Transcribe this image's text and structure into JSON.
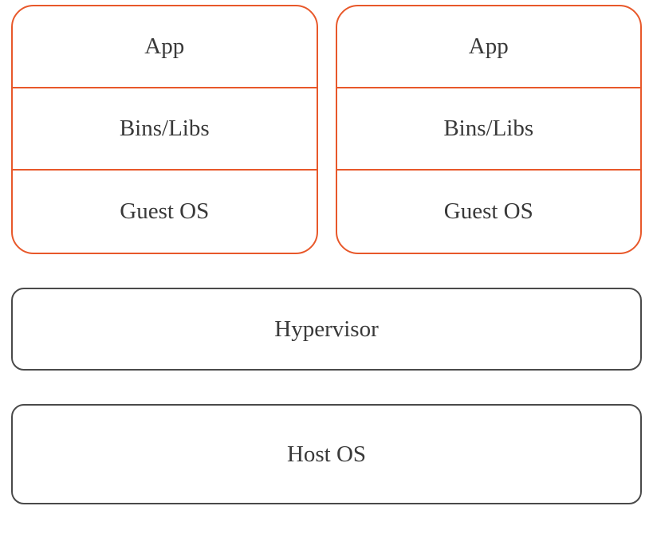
{
  "vms": [
    {
      "app": "App",
      "bins": "Bins/Libs",
      "guest": "Guest OS"
    },
    {
      "app": "App",
      "bins": "Bins/Libs",
      "guest": "Guest OS"
    }
  ],
  "hypervisor": "Hypervisor",
  "hostos": "Host OS",
  "colors": {
    "vmBorder": "#e8582a",
    "sysBorder": "#4a4a4a",
    "text": "#393939"
  }
}
